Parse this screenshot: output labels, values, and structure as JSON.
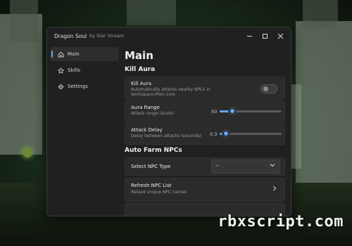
{
  "window": {
    "title": "Dragon Soul",
    "subtitle": "by Star Stream"
  },
  "sidebar": {
    "items": [
      {
        "label": "Main",
        "icon": "home-icon",
        "active": true
      },
      {
        "label": "Skills",
        "icon": "star-icon",
        "active": false
      },
      {
        "label": "Settings",
        "icon": "gear-icon",
        "active": false
      }
    ]
  },
  "main": {
    "title": "Main",
    "sections": {
      "kill_aura": "Kill Aura",
      "auto_farm": "Auto Farm NPCs"
    },
    "kill_aura_toggle": {
      "title": "Kill Aura",
      "description": "Automatically attacks nearby NPCs in workspace.Main.Live",
      "enabled": false
    },
    "aura_range": {
      "title": "Aura Range",
      "description": "Attack range (studs)",
      "value": "50",
      "fraction": 0.2
    },
    "attack_delay": {
      "title": "Attack Delay",
      "description": "Delay between attacks (seconds)",
      "value": "0.3",
      "fraction": 0.1
    },
    "npc_type": {
      "title": "Select NPC Type",
      "selected": "--"
    },
    "refresh_npc": {
      "title": "Refresh NPC List",
      "description": "Reload unique NPC names"
    }
  },
  "watermark": "rbxscript.com",
  "colors": {
    "accent": "#60a8ff",
    "window_bg": "#202020",
    "card_bg": "#2b2b2b"
  }
}
